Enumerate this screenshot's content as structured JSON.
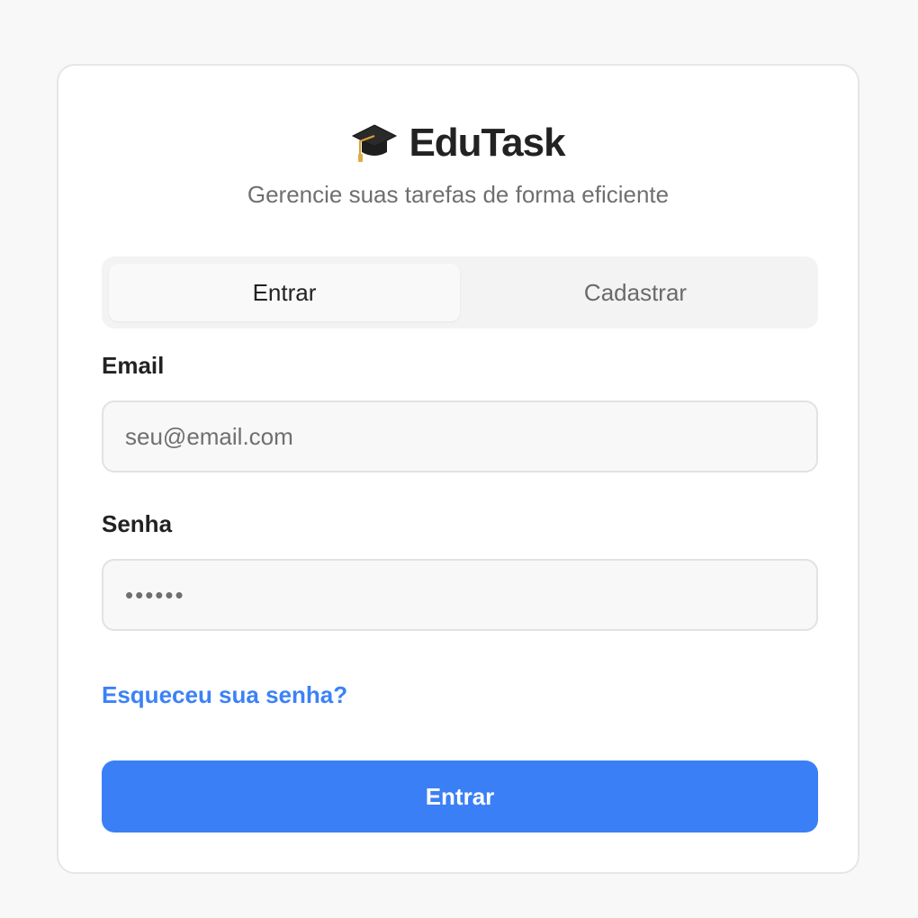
{
  "brand": {
    "title": "EduTask",
    "icon": "graduation-cap-icon"
  },
  "subtitle": "Gerencie suas tarefas de forma eficiente",
  "tabs": [
    {
      "label": "Entrar",
      "active": true
    },
    {
      "label": "Cadastrar",
      "active": false
    }
  ],
  "form": {
    "email_label": "Email",
    "email_placeholder": "seu@email.com",
    "email_value": "",
    "password_label": "Senha",
    "password_placeholder": "••••••",
    "password_value": ""
  },
  "forgot_link": "Esqueceu sua senha?",
  "submit_label": "Entrar",
  "colors": {
    "accent": "#3b7ff6",
    "link": "#3b82f6",
    "background": "#f8f8f8",
    "card": "#ffffff"
  }
}
